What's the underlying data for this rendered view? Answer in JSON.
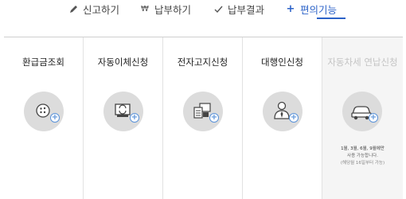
{
  "top_nav": {
    "items": [
      {
        "label": "신고하기",
        "icon": "pencil-icon"
      },
      {
        "label": "납부하기",
        "icon": "won-icon"
      },
      {
        "label": "납부결과",
        "icon": "check-icon"
      },
      {
        "label": "편의기능",
        "icon": "plus-icon",
        "active": true
      }
    ],
    "accent_color": "#2b62c8"
  },
  "services": [
    {
      "title": "환급금조회",
      "icon": "coins-icon"
    },
    {
      "title": "자동이체신청",
      "icon": "auto-transfer-icon"
    },
    {
      "title": "전자고지신청",
      "icon": "e-notice-icon"
    },
    {
      "title": "대행인신청",
      "icon": "agent-person-icon"
    },
    {
      "title": "자동차세 연납신청",
      "icon": "car-icon",
      "disabled": true,
      "note_line1": "1월, 3월, 6월, 9월에만",
      "note_line2": "사용 가능합니다.",
      "note_line3": "(해당월 16일부터 가능)"
    }
  ]
}
